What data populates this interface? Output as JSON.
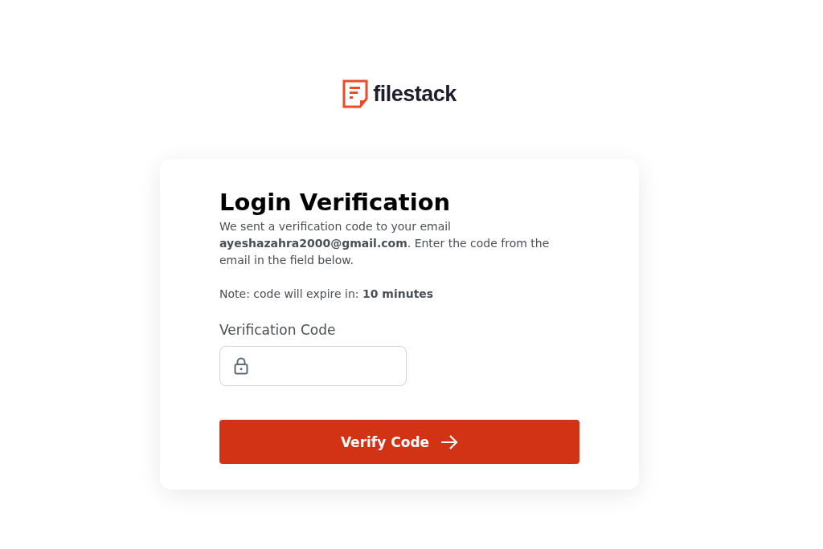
{
  "logo": {
    "text": "filestack"
  },
  "card": {
    "title": "Login Verification",
    "message": "We sent a verification code to your email **ayeshazahra2000@gmail.com**. Enter the code from the email in the field below.",
    "note": "Note: code will expire in: **10 minutes**",
    "field": {
      "label": "Verification Code"
    },
    "button": {
      "label": "Verify Code"
    }
  }
}
